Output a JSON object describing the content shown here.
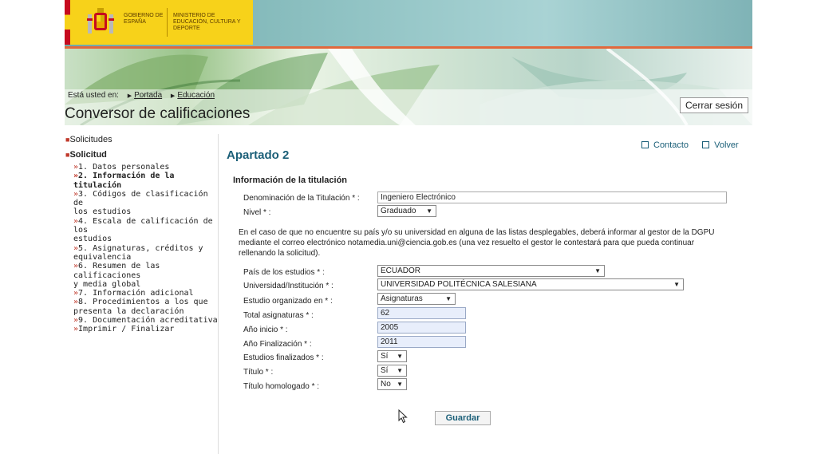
{
  "header": {
    "government": "GOBIERNO DE ESPAÑA",
    "ministry": "MINISTERIO DE EDUCACIÓN, CULTURA Y DEPORTE"
  },
  "breadcrumb": {
    "prefix": "Está usted en:",
    "items": [
      "Portada",
      "Educación"
    ]
  },
  "app_title": "Conversor de calificaciones",
  "logout_label": "Cerrar sesión",
  "sidebar": {
    "top_items": [
      "Solicitudes",
      "Solicitud"
    ],
    "steps": [
      {
        "label": "1. Datos personales",
        "lines": [
          "1. Datos personales"
        ]
      },
      {
        "label": "2. Información de la titulación",
        "lines": [
          "2. Información de la",
          "titulación"
        ]
      },
      {
        "label": "3. Códigos de clasificación de los estudios",
        "lines": [
          "3. Códigos de clasificación de",
          "los estudios"
        ]
      },
      {
        "label": "4. Escala de calificación de los estudios",
        "lines": [
          "4. Escala de calificación de los",
          "estudios"
        ]
      },
      {
        "label": "5. Asignaturas, créditos y equivalencia",
        "lines": [
          "5. Asignaturas, créditos y",
          "equivalencia"
        ]
      },
      {
        "label": "6. Resumen de las calificaciones y media global",
        "lines": [
          "6. Resumen de las calificaciones",
          "y media global"
        ]
      },
      {
        "label": "7. Información adicional",
        "lines": [
          "7. Información adicional"
        ]
      },
      {
        "label": "8. Procedimientos a los que presenta la declaración",
        "lines": [
          "8. Procedimientos a los que",
          "presenta la declaración"
        ]
      },
      {
        "label": "9. Documentación acreditativa",
        "lines": [
          "9. Documentación acreditativa"
        ]
      },
      {
        "label": "Imprimir / Finalizar",
        "lines": [
          "Imprimir / Finalizar"
        ]
      }
    ]
  },
  "links": {
    "contact": "Contacto",
    "back": "Volver"
  },
  "section_title": "Apartado 2",
  "subtitle": "Información de la titulación",
  "form": {
    "degree_name": {
      "label": "Denominación de la Titulación * :",
      "value": "Ingeniero Electrónico"
    },
    "level": {
      "label": "Nivel * :",
      "value": "Graduado"
    },
    "note": "En el caso de que no encuentre su país y/o su universidad en alguna de las listas desplegables, deberá informar al gestor de la DGPU mediante el correo electrónico notamedia.uni@ciencia.gob.es (una vez resuelto el gestor le contestará para que pueda continuar rellenando la solicitud).",
    "country": {
      "label": "País de los estudios * :",
      "value": "ECUADOR"
    },
    "university": {
      "label": "Universidad/Institución * :",
      "value": "UNIVERSIDAD POLITÉCNICA SALESIANA"
    },
    "organized_in": {
      "label": "Estudio organizado en * :",
      "value": "Asignaturas"
    },
    "total_subjects": {
      "label": "Total asignaturas * :",
      "value": "62"
    },
    "start_year": {
      "label": "Año inicio * :",
      "value": "2005"
    },
    "end_year": {
      "label": "Año Finalización * :",
      "value": "2011"
    },
    "finished": {
      "label": "Estudios finalizados * :",
      "value": "Sí"
    },
    "degree": {
      "label": "Título * :",
      "value": "Sí"
    },
    "homologated": {
      "label": "Título homologado * :",
      "value": "No"
    },
    "save_label": "Guardar"
  },
  "colors": {
    "accent": "#1b5f78",
    "banner": "#f7d21a",
    "bullet": "#c0392b"
  }
}
